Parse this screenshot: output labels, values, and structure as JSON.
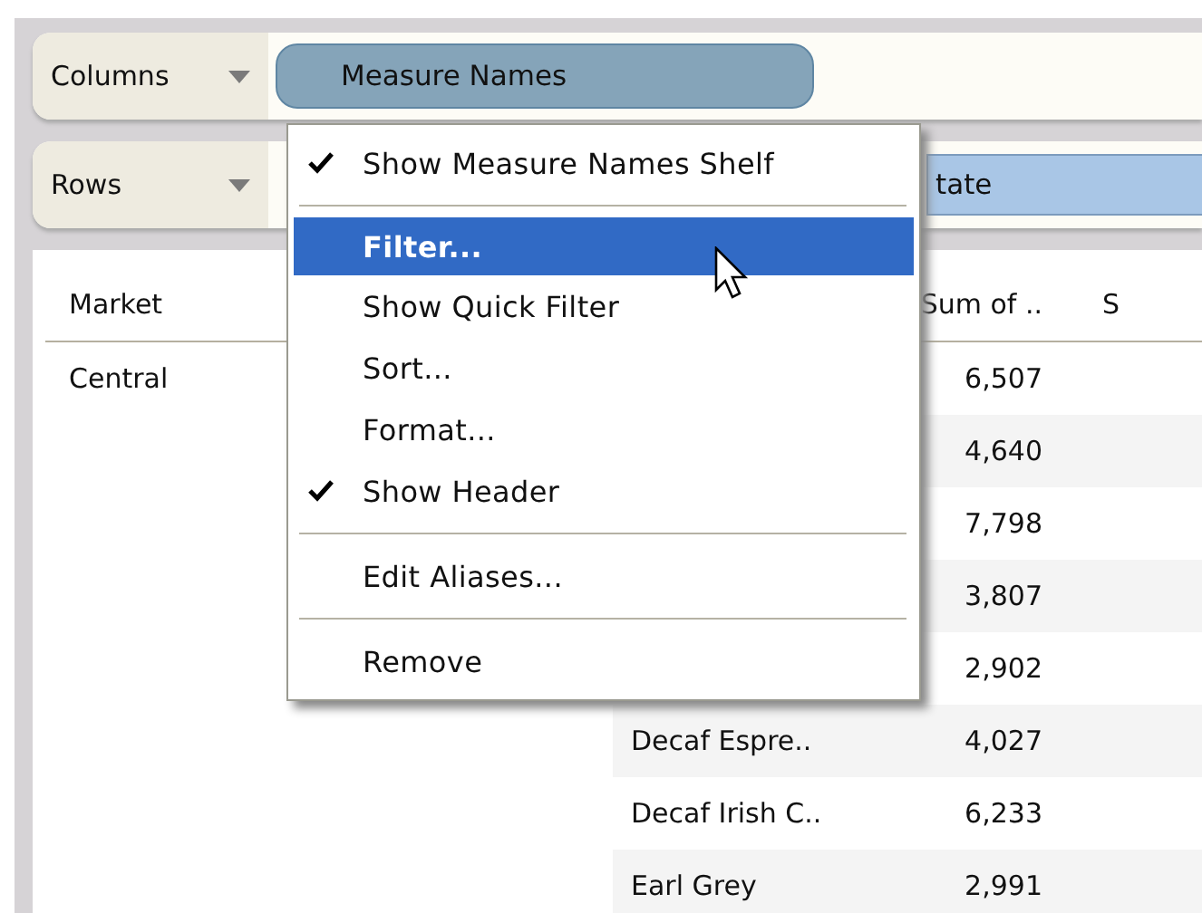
{
  "shelves": [
    {
      "label": "Columns",
      "pill": "Measure Names",
      "kind": "measure"
    },
    {
      "label": "Rows",
      "pill": "tate",
      "kind": "dimension"
    }
  ],
  "table": {
    "columns": [
      "Market",
      "Sum of ..",
      "S"
    ],
    "rows": [
      {
        "market": "Central",
        "product": "",
        "sum": "6,507"
      },
      {
        "market": "",
        "product": "",
        "sum": "4,640"
      },
      {
        "market": "",
        "product": "",
        "sum": "7,798"
      },
      {
        "market": "",
        "product": "",
        "sum": "3,807"
      },
      {
        "market": "",
        "product": "",
        "sum": "2,902"
      },
      {
        "market": "",
        "product": "Decaf Espre..",
        "sum": "4,027"
      },
      {
        "market": "",
        "product": "Decaf Irish C..",
        "sum": "6,233"
      },
      {
        "market": "",
        "product": "Earl Grey",
        "sum": "2,991"
      }
    ]
  },
  "context_menu": {
    "items": [
      {
        "kind": "item",
        "label": "Show Measure Names Shelf",
        "checked": true,
        "selected": false
      },
      {
        "kind": "separator"
      },
      {
        "kind": "item",
        "label": "Filter...",
        "checked": false,
        "selected": true
      },
      {
        "kind": "item",
        "label": "Show Quick Filter",
        "checked": false,
        "selected": false
      },
      {
        "kind": "item",
        "label": "Sort...",
        "checked": false,
        "selected": false
      },
      {
        "kind": "item",
        "label": "Format...",
        "checked": false,
        "selected": false
      },
      {
        "kind": "item",
        "label": "Show Header",
        "checked": true,
        "selected": false
      },
      {
        "kind": "separator"
      },
      {
        "kind": "item",
        "label": "Edit Aliases...",
        "checked": false,
        "selected": false
      },
      {
        "kind": "separator"
      },
      {
        "kind": "item",
        "label": "Remove",
        "checked": false,
        "selected": false
      }
    ]
  }
}
